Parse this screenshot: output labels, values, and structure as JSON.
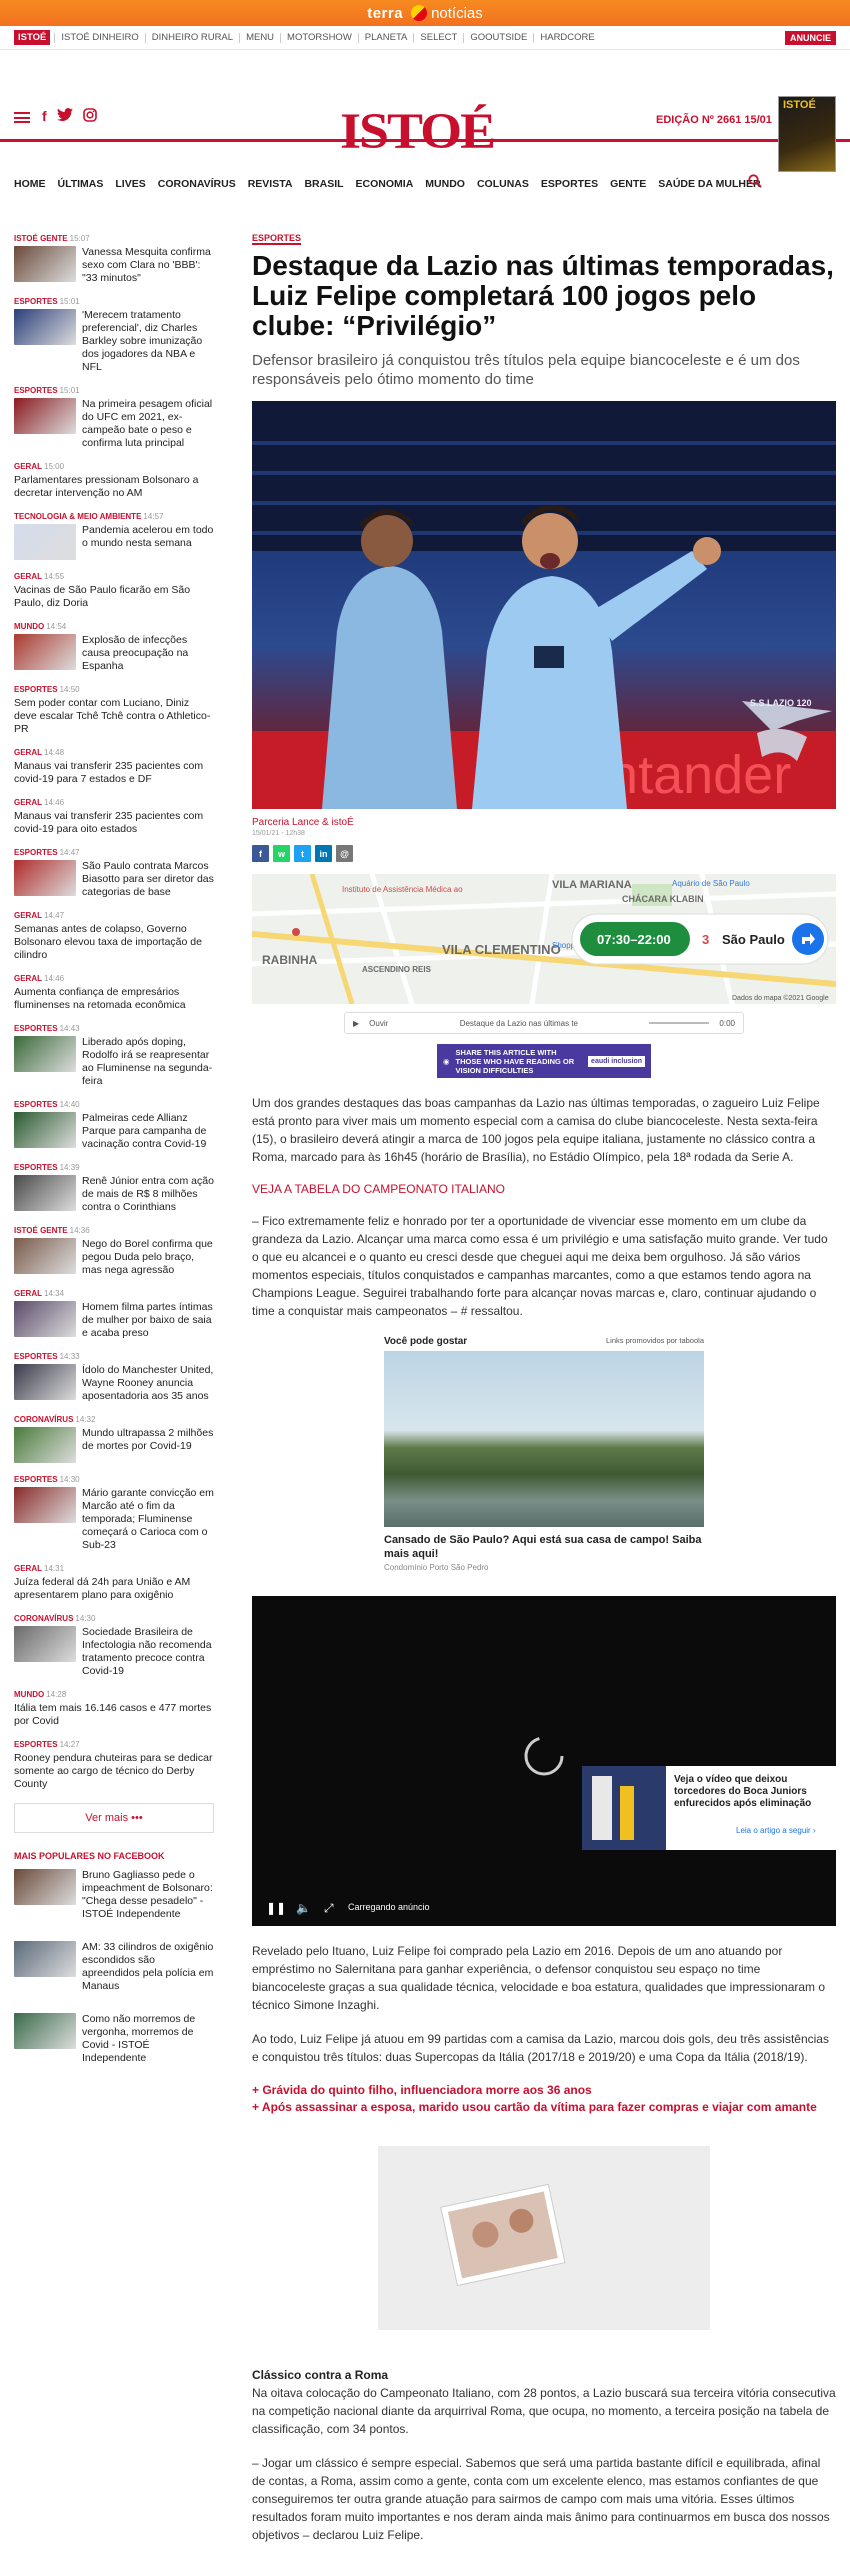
{
  "topbar": {
    "logo": "terra",
    "section": "notícias"
  },
  "topnav": {
    "brand": "ISTOÉ",
    "items": [
      "ISTOÉ DINHEIRO",
      "DINHEIRO RURAL",
      "MENU",
      "MOTORSHOW",
      "PLANETA",
      "SELECT",
      "GOOUTSIDE",
      "HARDCORE"
    ],
    "cta": "ANUNCIE"
  },
  "header": {
    "logo": "ISTOÉ",
    "social": [
      "f",
      "twitter",
      "instagram"
    ],
    "edition": "EDIÇÃO Nº 2661 15/01",
    "cover_title": "ISTOÉ",
    "menu": [
      "HOME",
      "ÚLTIMAS",
      "LIVES",
      "CORONAVÍRUS",
      "REVISTA",
      "BRASIL",
      "ECONOMIA",
      "MUNDO",
      "COLUNAS",
      "ESPORTES",
      "GENTE",
      "SAÚDE DA MULHER"
    ]
  },
  "sidebar": {
    "items": [
      {
        "cat": "ISTOÉ GENTE",
        "time": "15:07",
        "title": "Vanessa Mesquita confirma sexo com Clara no 'BBB': \"33 minutos\"",
        "thumb": "#6a4a3a"
      },
      {
        "cat": "ESPORTES",
        "time": "15:01",
        "title": "'Merecem tratamento preferencial', diz Charles Barkley sobre imunização dos jogadores da NBA e NFL",
        "thumb": "#2b3e7a"
      },
      {
        "cat": "ESPORTES",
        "time": "15:01",
        "title": "Na primeira pesagem oficial do UFC em 2021, ex-campeão bate o peso e confirma luta principal",
        "thumb": "#8a1a20"
      },
      {
        "cat": "GERAL",
        "time": "15:00",
        "title": "Parlamentares pressionam Bolsonaro a decretar intervenção no AM",
        "thumb": ""
      },
      {
        "cat": "TECNOLOGIA & MEIO AMBIENTE",
        "time": "14:57",
        "title": "Pandemia acelerou em todo o mundo nesta semana",
        "thumb": "#d4dcec"
      },
      {
        "cat": "GERAL",
        "time": "14:55",
        "title": "Vacinas de São Paulo ficarão em São Paulo, diz Doria",
        "thumb": ""
      },
      {
        "cat": "MUNDO",
        "time": "14:54",
        "title": "Explosão de infecções causa preocupação na Espanha",
        "thumb": "#aa3a30"
      },
      {
        "cat": "ESPORTES",
        "time": "14:50",
        "title": "Sem poder contar com Luciano, Diniz deve escalar Tchê Tchê contra o Athletico-PR",
        "thumb": ""
      },
      {
        "cat": "GERAL",
        "time": "14:48",
        "title": "Manaus vai transferir 235 pacientes com covid-19 para 7 estados e DF",
        "thumb": ""
      },
      {
        "cat": "GERAL",
        "time": "14:46",
        "title": "Manaus vai transferir 235 pacientes com covid-19 para oito estados",
        "thumb": ""
      },
      {
        "cat": "ESPORTES",
        "time": "14:47",
        "title": "São Paulo contrata Marcos Biasotto para ser diretor das categorias de base",
        "thumb": "#b02a2a"
      },
      {
        "cat": "GERAL",
        "time": "14:47",
        "title": "Semanas antes de colapso, Governo Bolsonaro elevou taxa de importação de cilindro",
        "thumb": ""
      },
      {
        "cat": "GERAL",
        "time": "14:46",
        "title": "Aumenta confiança de empresários fluminenses na retomada econômica",
        "thumb": ""
      },
      {
        "cat": "ESPORTES",
        "time": "14:43",
        "title": "Liberado após doping, Rodolfo irá se reapresentar ao Fluminense na segunda-feira",
        "thumb": "#3a6a3a"
      },
      {
        "cat": "ESPORTES",
        "time": "14:40",
        "title": "Palmeiras cede Allianz Parque para campanha de vacinação contra Covid-19",
        "thumb": "#2a5a30"
      },
      {
        "cat": "ESPORTES",
        "time": "14:39",
        "title": "Renê Júnior entra com ação de mais de R$ 8 milhões contra o Corinthians",
        "thumb": "#4a4a4a"
      },
      {
        "cat": "ISTOÉ GENTE",
        "time": "14:36",
        "title": "Nego do Borel confirma que pegou Duda pelo braço, mas nega agressão",
        "thumb": "#7a5a4a"
      },
      {
        "cat": "GERAL",
        "time": "14:34",
        "title": "Homem filma partes íntimas de mulher por baixo de saia e acaba preso",
        "thumb": "#5a4a6a"
      },
      {
        "cat": "ESPORTES",
        "time": "14:33",
        "title": "Ídolo do Manchester United, Wayne Rooney anuncia aposentadoria aos 35 anos",
        "thumb": "#3a3a4a"
      },
      {
        "cat": "CORONAVÍRUS",
        "time": "14:32",
        "title": "Mundo ultrapassa 2 milhões de mortes por Covid-19",
        "thumb": "#4a7a3a"
      },
      {
        "cat": "ESPORTES",
        "time": "14:30",
        "title": "Mário garante convicção em Marcão até o fim da temporada; Fluminense começará o Carioca com o Sub-23",
        "thumb": "#8a2a2a"
      },
      {
        "cat": "GERAL",
        "time": "14:31",
        "title": "Juíza federal dá 24h para União e AM apresentarem plano para oxigênio",
        "thumb": ""
      },
      {
        "cat": "CORONAVÍRUS",
        "time": "14:30",
        "title": "Sociedade Brasileira de Infectologia não recomenda tratamento precoce contra Covid-19",
        "thumb": "#6a6a6a"
      },
      {
        "cat": "MUNDO",
        "time": "14:28",
        "title": "Itália tem mais 16.146 casos e 477 mortes por Covid",
        "thumb": ""
      },
      {
        "cat": "ESPORTES",
        "time": "14:27",
        "title": "Rooney pendura chuteiras para se dedicar somente ao cargo de técnico do Derby County",
        "thumb": ""
      }
    ],
    "more": "Ver mais",
    "popular_head": "MAIS POPULARES NO FACEBOOK",
    "popular": [
      {
        "title": "Bruno Gagliasso pede o impeachment de Bolsonaro: \"Chega desse pesadelo\" - ISTOÉ Independente",
        "thumb": "#6a4a3a"
      },
      {
        "title": "AM: 33 cilindros de oxigênio escondidos são apreendidos pela polícia em Manaus",
        "thumb": "#5a6a7a"
      },
      {
        "title": "Como não morremos de vergonha, morremos de Covid - ISTOÉ Independente",
        "thumb": "#3a6a4a"
      }
    ]
  },
  "article": {
    "category": "ESPORTES",
    "title": "Destaque da Lazio nas últimas temporadas, Luiz Felipe completará 100 jogos pelo clube: “Privilégio”",
    "subtitle": "Defensor brasileiro já conquistou três títulos pela equipe biancoceleste e é um dos responsáveis pelo ótimo momento do time",
    "hero_caption": "S.S.LAZIO 120",
    "hero_ad_text": "Santander",
    "credit": "Parceria Lance & istoÉ",
    "date": "15/01/21 - 12h38",
    "share": [
      "f",
      "w",
      "t",
      "in",
      "@"
    ],
    "map": {
      "labels": [
        "VILA MARIANA",
        "CHÁCARA KLABIN",
        "VILA CLEMENTINO",
        "RABINHA",
        "ASCENDINO REIS",
        "Aquário de São Paulo",
        "Instituto de Assistência Médica ao",
        "Shopping Santa Cruz"
      ],
      "hours": "07:30–22:00",
      "count": "3",
      "city": "São Paulo",
      "footer": "Dados do mapa ©2021 Google"
    },
    "audio": {
      "label": "Ouvir",
      "title": "Destaque da Lazio nas últimas te",
      "time": "0:00"
    },
    "banner": {
      "text": "SHARE THIS ARTICLE WITH THOSE WHO HAVE READING OR VISION DIFFICULTIES",
      "brand": "eaudi inclusion"
    },
    "paragraphs": [
      "Um dos grandes destaques das boas campanhas da Lazio nas últimas temporadas, o zagueiro Luiz Felipe está pronto para viver mais um momento especial com a camisa do clube biancoceleste. Nesta sexta-feira (15), o brasileiro deverá atingir a marca de 100 jogos pela equipe italiana, justamente no clássico contra a Roma, marcado para às 16h45 (horário de Brasília), no Estádio Olímpico, pela 18ª rodada da Serie A.",
      "VEJA A TABELA DO CAMPEONATO ITALIANO",
      "– Fico extremamente feliz e honrado por ter a oportunidade de vivenciar esse momento em um clube da grandeza da Lazio. Alcançar uma marca como essa é um privilégio e uma satisfação muito grande. Ver tudo o que eu alcancei e o quanto eu cresci desde que cheguei aqui me deixa bem orgulhoso. Já são vários momentos especiais, títulos conquistados e campanhas marcantes, como a que estamos tendo agora na Champions League. Seguirei trabalhando forte para alcançar novas marcas e, claro, continuar ajudando o time a conquistar mais campeonatos – # ressaltou.",
      "Revelado pelo Ituano, Luiz Felipe foi comprado pela Lazio em 2016. Depois de um ano atuando por empréstimo no Salernitana para ganhar experiência, o defensor conquistou seu espaço no time biancoceleste graças a sua qualidade técnica, velocidade e boa estatura, qualidades que impressionaram o técnico Simone Inzaghi.",
      "Ao todo, Luiz Felipe já atuou em 99 partidas com a camisa da Lazio, marcou dois gols, deu três assistências e conquistou três títulos: duas Supercopas da Itália (2017/18 e 2019/20) e uma Copa da Itália (2018/19).",
      "Na oitava colocação do Campeonato Italiano, com 28 pontos, a Lazio buscará sua terceira vitória consecutiva na competição nacional diante da arquirrival Roma, que ocupa, no momento, a terceira posição na tabela de classificação, com 34 pontos.",
      "– Jogar um clássico é sempre especial. Sabemos que será uma partida bastante difícil e equilibrada, afinal de contas, a Roma, assim como a gente, conta com um excelente elenco, mas estamos confiantes de que conseguiremos ter outra grande atuação para sairmos de campo com mais uma vitória. Esses últimos resultados foram muito importantes e nos deram ainda mais ânimo para continuarmos em busca dos nossos objetivos – declarou Luiz Felipe."
    ],
    "promo": {
      "head": "Você pode gostar",
      "sponsor": "Links promovidos por taboola",
      "title": "Cansado de São Paulo? Aqui está sua casa de campo! Saiba mais aqui!",
      "source": "Condomínio Porto São Pedro"
    },
    "video": {
      "status": "Carregando anúncio",
      "card_title": "Veja o vídeo que deixou torcedores do Boca Juniors enfurecidos após eliminação",
      "card_link": "Leia o artigo a seguir ›"
    },
    "related": [
      "+ Grávida do quinto filho, influenciadora morre aos 36 anos",
      "+ Após assassinar a esposa, marido usou cartão da vítima para fazer compras e viajar com amante"
    ],
    "subhead": "Clássico contra a Roma"
  },
  "colors": {
    "brand": "#c8102e",
    "terra": "#f37021"
  }
}
